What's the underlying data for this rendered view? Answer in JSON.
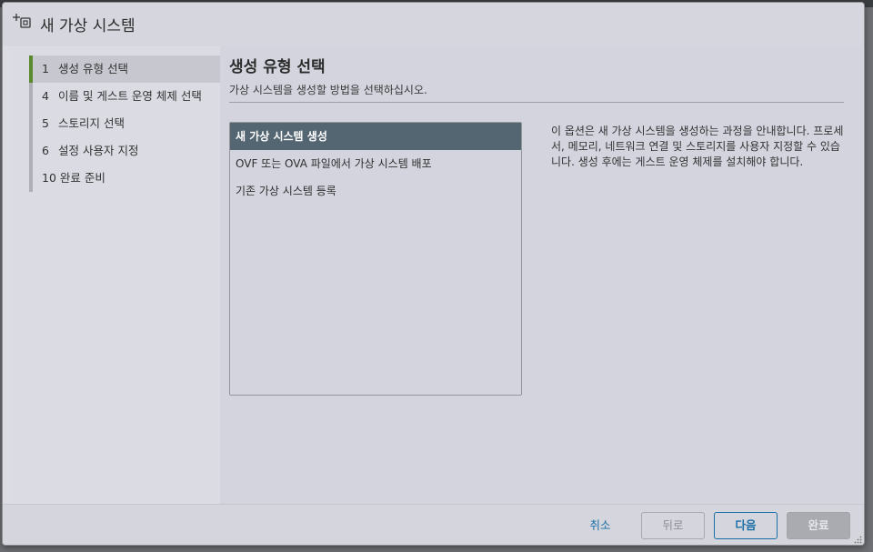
{
  "dialog": {
    "title": "새 가상 시스템",
    "icon": "new-vm-icon"
  },
  "steps": [
    {
      "num": "1",
      "label": "생성 유형 선택",
      "active": true
    },
    {
      "num": "4",
      "label": "이름 및 게스트 운영 체제 선택",
      "active": false
    },
    {
      "num": "5",
      "label": "스토리지 선택",
      "active": false
    },
    {
      "num": "6",
      "label": "설정 사용자 지정",
      "active": false
    },
    {
      "num": "10",
      "label": "완료 준비",
      "active": false
    }
  ],
  "main": {
    "title": "생성 유형 선택",
    "subtitle": "가상 시스템을 생성할 방법을 선택하십시오.",
    "options": [
      {
        "label": "새 가상 시스템 생성",
        "selected": true
      },
      {
        "label": "OVF 또는 OVA 파일에서 가상 시스템 배포",
        "selected": false
      },
      {
        "label": "기존 가상 시스템 등록",
        "selected": false
      }
    ],
    "description": "이 옵션은 새 가상 시스템을 생성하는 과정을 안내합니다. 프로세서, 메모리, 네트워크 연결 및 스토리지를 사용자 지정할 수 있습니다. 생성 후에는 게스트 운영 체제를 설치해야 합니다."
  },
  "footer": {
    "cancel": "취소",
    "back": "뒤로",
    "next": "다음",
    "finish": "완료"
  },
  "colors": {
    "active_step_marker": "#5b8a2e",
    "selected_option_bg": "#546672",
    "link_blue": "#1b6fa6"
  }
}
